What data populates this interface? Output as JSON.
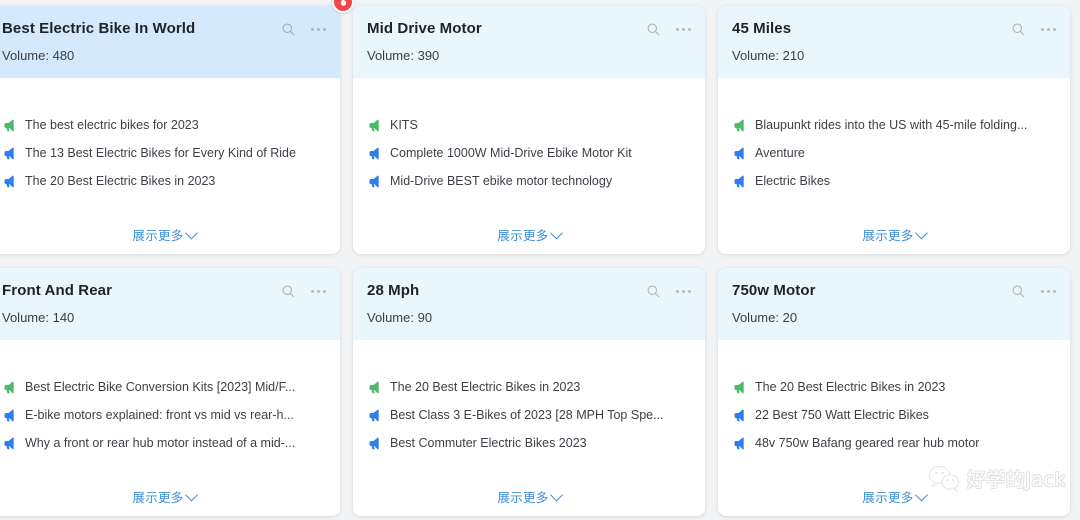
{
  "colors": {
    "page_background": "#f2f3f5",
    "card_background": "#ffffff",
    "header_background": "#eaf6fe",
    "header_background_selected": "#d4e9fb",
    "link_blue": "#3f8fd8",
    "badge_red": "#f0474c",
    "icon_green": "#4cba6a",
    "icon_blue": "#2d7ff0",
    "title_text": "#1f2329",
    "body_text": "#3d4147"
  },
  "badge": {
    "name": "hot-badge",
    "icon": "flame-icon",
    "color": "#f0474c"
  },
  "watermark": {
    "icon": "wechat-icon",
    "text": "好学的Jack"
  },
  "card_actions": {
    "search_icon": "search-icon",
    "more_icon": "more-options-icon",
    "show_more_label": "展示更多",
    "chevron_icon": "chevron-down-icon"
  },
  "volume_prefix": "Volume: ",
  "cards": [
    {
      "title": "Best Electric Bike In World",
      "volume_label": "Volume: 480",
      "volume": 480,
      "selected": true,
      "keywords": [
        {
          "text": "The best electric bikes for 2023",
          "icon": "megaphone-icon",
          "icon_color": "#4cba6a"
        },
        {
          "text": "The 13 Best Electric Bikes for Every Kind of Ride",
          "icon": "megaphone-icon",
          "icon_color": "#2d7ff0"
        },
        {
          "text": "The 20 Best Electric Bikes in 2023",
          "icon": "megaphone-icon",
          "icon_color": "#2d7ff0"
        }
      ]
    },
    {
      "title": "Mid Drive Motor",
      "volume_label": "Volume: 390",
      "volume": 390,
      "selected": false,
      "keywords": [
        {
          "text": "KITS",
          "icon": "megaphone-icon",
          "icon_color": "#4cba6a"
        },
        {
          "text": "Complete 1000W Mid-Drive Ebike Motor Kit",
          "icon": "megaphone-icon",
          "icon_color": "#2d7ff0"
        },
        {
          "text": "Mid-Drive BEST ebike motor technology",
          "icon": "megaphone-icon",
          "icon_color": "#2d7ff0"
        }
      ]
    },
    {
      "title": "45 Miles",
      "volume_label": "Volume: 210",
      "volume": 210,
      "selected": false,
      "keywords": [
        {
          "text": "Blaupunkt rides into the US with 45-mile folding...",
          "icon": "megaphone-icon",
          "icon_color": "#4cba6a"
        },
        {
          "text": "Aventure",
          "icon": "megaphone-icon",
          "icon_color": "#2d7ff0"
        },
        {
          "text": "Electric Bikes",
          "icon": "megaphone-icon",
          "icon_color": "#2d7ff0"
        }
      ]
    },
    {
      "title": "Front And Rear",
      "volume_label": "Volume: 140",
      "volume": 140,
      "selected": false,
      "keywords": [
        {
          "text": "Best Electric Bike Conversion Kits [2023] Mid/F...",
          "icon": "megaphone-icon",
          "icon_color": "#4cba6a"
        },
        {
          "text": "E-bike motors explained: front vs mid vs rear-h...",
          "icon": "megaphone-icon",
          "icon_color": "#2d7ff0"
        },
        {
          "text": "Why a front or rear hub motor instead of a mid-...",
          "icon": "megaphone-icon",
          "icon_color": "#2d7ff0"
        }
      ]
    },
    {
      "title": "28 Mph",
      "volume_label": "Volume: 90",
      "volume": 90,
      "selected": false,
      "keywords": [
        {
          "text": "The 20 Best Electric Bikes in 2023",
          "icon": "megaphone-icon",
          "icon_color": "#4cba6a"
        },
        {
          "text": "Best Class 3 E-Bikes of 2023 [28 MPH Top Spe...",
          "icon": "megaphone-icon",
          "icon_color": "#2d7ff0"
        },
        {
          "text": "Best Commuter Electric Bikes 2023",
          "icon": "megaphone-icon",
          "icon_color": "#2d7ff0"
        }
      ]
    },
    {
      "title": "750w Motor",
      "volume_label": "Volume: 20",
      "volume": 20,
      "selected": false,
      "keywords": [
        {
          "text": "The 20 Best Electric Bikes in 2023",
          "icon": "megaphone-icon",
          "icon_color": "#4cba6a"
        },
        {
          "text": "22 Best 750 Watt Electric Bikes",
          "icon": "megaphone-icon",
          "icon_color": "#2d7ff0"
        },
        {
          "text": "48v 750w Bafang geared rear hub motor",
          "icon": "megaphone-icon",
          "icon_color": "#2d7ff0"
        }
      ]
    }
  ]
}
